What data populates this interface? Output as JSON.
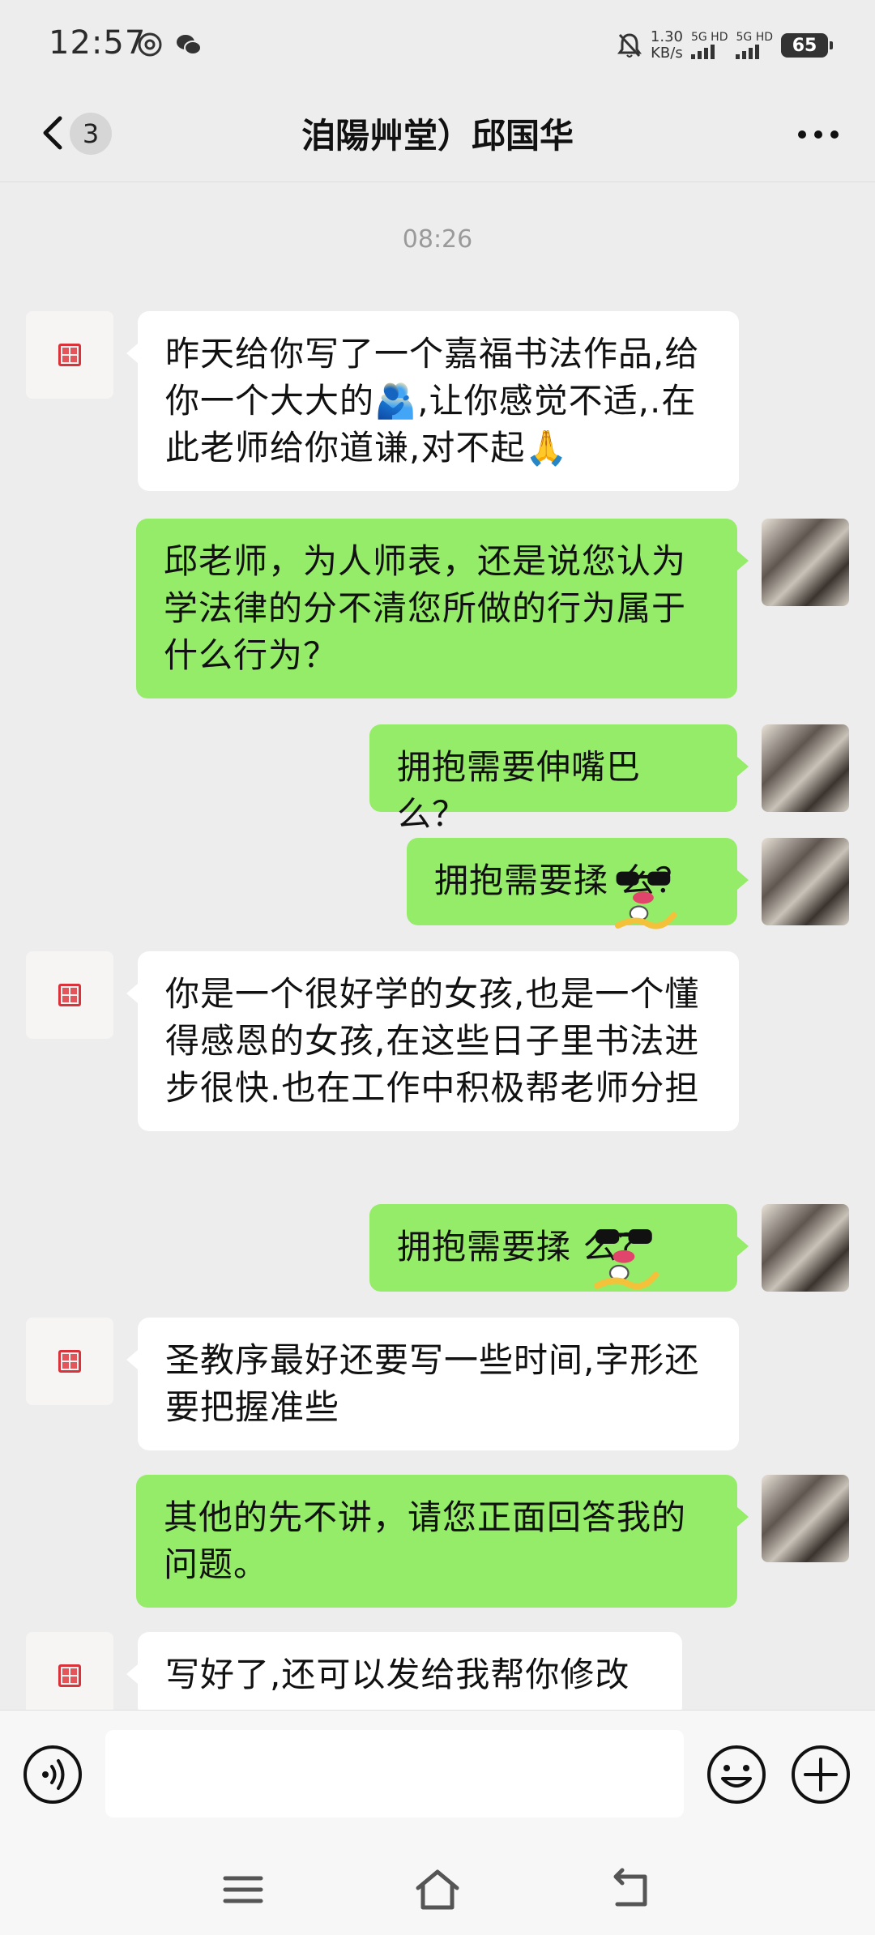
{
  "status_bar": {
    "time": "12:57",
    "net_speed_value": "1.30",
    "net_speed_unit": "KB/s",
    "sim1_label": "5G HD",
    "sim2_label": "5G HD",
    "battery": "65"
  },
  "nav": {
    "unread_count": "3",
    "title": "洎陽艸堂）邱国华"
  },
  "chat": {
    "timestamp": "08:26",
    "messages": [
      {
        "from": "them",
        "text": "昨天给你写了一个嘉福书法作品,给你一个大大的🫂,让你感觉不适,.在此老师给你道谦,对不起🙏"
      },
      {
        "from": "me",
        "text": "邱老师，为人师表，还是说您认为学法律的分不清您所做的行为属于什么行为？"
      },
      {
        "from": "me",
        "text": "拥抱需要伸嘴巴么？"
      },
      {
        "from": "me",
        "text": "拥抱需要揉    么？"
      },
      {
        "from": "them",
        "text": "你是一个很好学的女孩,也是一个懂得感恩的女孩,在这些日子里书法进步很快.也在工作中积极帮老师分担"
      },
      {
        "from": "me",
        "text": "拥抱需要揉    么？"
      },
      {
        "from": "them",
        "text": "圣教序最好还要写一些时间,字形还要把握准些"
      },
      {
        "from": "me",
        "text": "其他的先不讲，请您正面回答我的问题。"
      },
      {
        "from": "them",
        "text": "写好了,还可以发给我帮你修改"
      }
    ]
  },
  "input": {
    "value": ""
  },
  "icons": {
    "back": "chevron-left-icon",
    "more": "more-dots-icon",
    "voice": "voice-icon",
    "emoji": "emoji-icon",
    "plus": "plus-icon",
    "menu": "menu-icon",
    "home": "home-icon",
    "return": "back-icon"
  },
  "colors": {
    "bubble_out": "#95ec69",
    "bubble_in": "#ffffff",
    "background": "#ededed"
  }
}
